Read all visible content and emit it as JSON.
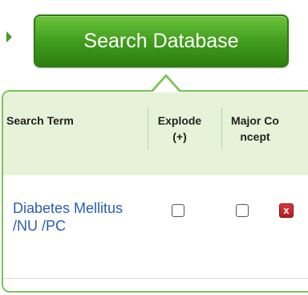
{
  "search_button": {
    "label": "Search Database"
  },
  "table": {
    "columns": {
      "term": "Search Term",
      "explode": "Explode (+)",
      "major": "Major Co ncept"
    },
    "rows": [
      {
        "term": "Diabetes Mellitus /NU /PC",
        "explode": false,
        "major": false,
        "delete_icon": "close-icon"
      }
    ]
  },
  "colors": {
    "button_green": "#3f9a1c",
    "panel_border": "#7cc45a",
    "header_bg": "#e6f3d8",
    "link_blue": "#2a5db0",
    "delete_red": "#c4282c"
  }
}
